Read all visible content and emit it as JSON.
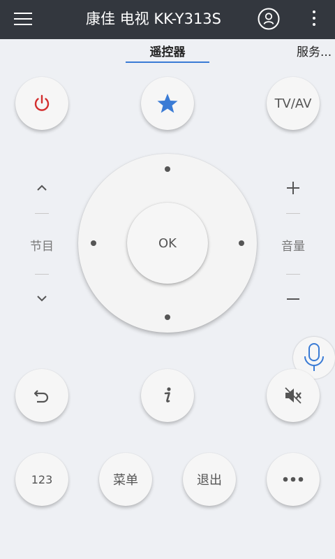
{
  "header": {
    "title": "康佳 电视 KK-Y313S",
    "menu_icon": "hamburger-icon",
    "user_icon": "user-icon",
    "more_icon": "more-vertical-icon"
  },
  "tabs": [
    {
      "label": "遥控器",
      "active": true
    },
    {
      "label": "服务..."
    }
  ],
  "buttons": {
    "power_icon": "power-icon",
    "favorite_icon": "star-icon",
    "tv_av": "TV/AV",
    "ok": "OK",
    "back_icon": "back-arrow-icon",
    "info_icon": "info-icon",
    "mute_icon": "mute-icon",
    "num": "123",
    "menu": "菜单",
    "exit": "退出",
    "more_icon": "more-horizontal-icon"
  },
  "channel": {
    "label": "节目"
  },
  "volume": {
    "label": "音量"
  },
  "voice": {
    "icon": "microphone-icon"
  },
  "colors": {
    "header_bg": "#33373e",
    "accent": "#3a7bd5",
    "power": "#d32f2f",
    "background": "#eef0f4"
  }
}
